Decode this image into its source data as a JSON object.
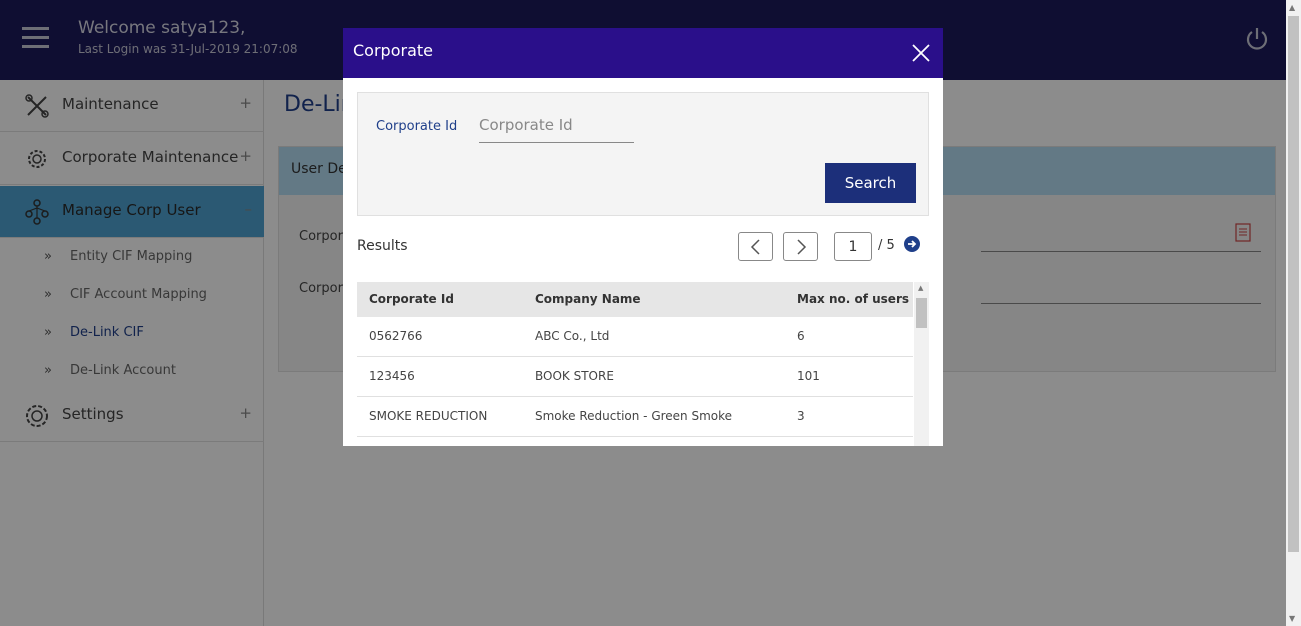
{
  "header": {
    "welcome": "Welcome satya123,",
    "last_login": "Last Login was 31-Jul-2019 21:07:08"
  },
  "sidebar": {
    "items": [
      {
        "label": "Maintenance",
        "icon": "tools-icon",
        "toggle": "+"
      },
      {
        "label": "Corporate Maintenance",
        "icon": "gear-icon",
        "toggle": "+"
      },
      {
        "label": "Manage Corp User",
        "icon": "org-chart-icon",
        "toggle": "–"
      },
      {
        "label": "Settings",
        "icon": "settings-gear-icon",
        "toggle": "+"
      }
    ],
    "sub_items": [
      {
        "label": "Entity CIF Mapping"
      },
      {
        "label": "CIF Account Mapping"
      },
      {
        "label": "De-Link CIF"
      },
      {
        "label": "De-Link Account"
      }
    ]
  },
  "main": {
    "title": "De-Link CIF",
    "panel_header": "User De",
    "label_1": "Corpora",
    "label_2": "Corpora"
  },
  "modal": {
    "title": "Corporate",
    "search_label": "Corporate Id",
    "search_placeholder": "Corporate Id",
    "search_button": "Search",
    "results_label": "Results",
    "page_current": "1",
    "page_total": "/ 5",
    "table": {
      "headers": [
        "Corporate Id",
        "Company Name",
        "Max no. of users"
      ],
      "rows": [
        [
          "0562766",
          "ABC Co., Ltd",
          "6"
        ],
        [
          "123456",
          "BOOK STORE",
          "101"
        ],
        [
          "SMOKE REDUCTION",
          "Smoke Reduction - Green Smoke",
          "3"
        ]
      ]
    }
  },
  "colors": {
    "header_bg": "#1c1a5c",
    "modal_header_bg": "#2a0f8a",
    "button_bg": "#1c2f7a",
    "active_item_bg": "#4fa3d1"
  }
}
